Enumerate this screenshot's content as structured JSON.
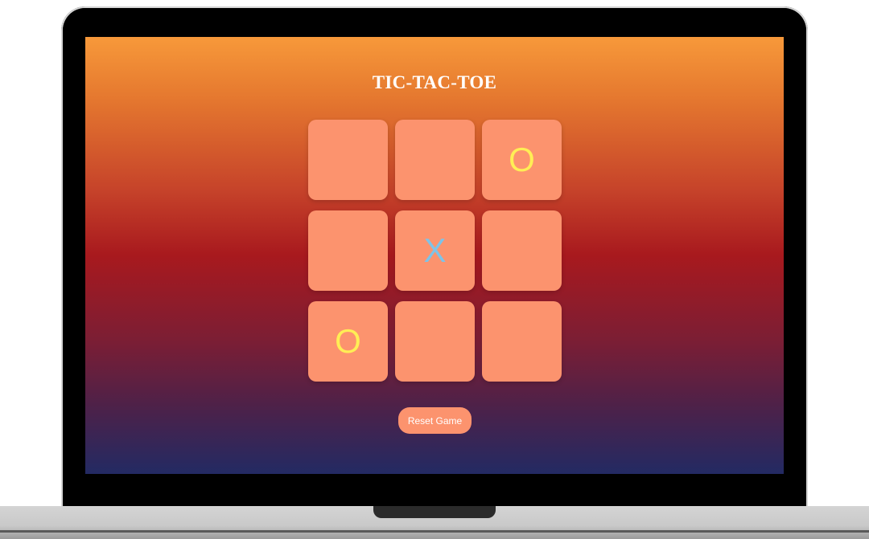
{
  "game": {
    "title": "TIC-TAC-TOE",
    "board": [
      {
        "value": ""
      },
      {
        "value": ""
      },
      {
        "value": "O"
      },
      {
        "value": ""
      },
      {
        "value": "X"
      },
      {
        "value": ""
      },
      {
        "value": "O"
      },
      {
        "value": ""
      },
      {
        "value": ""
      }
    ],
    "reset_label": "Reset Game"
  },
  "colors": {
    "cell_background": "#fc936e",
    "mark_o": "#ffee55",
    "mark_x": "#7ec3e8",
    "gradient_top": "#f7993a",
    "gradient_middle": "#a8191e",
    "gradient_bottom": "#232a63"
  }
}
